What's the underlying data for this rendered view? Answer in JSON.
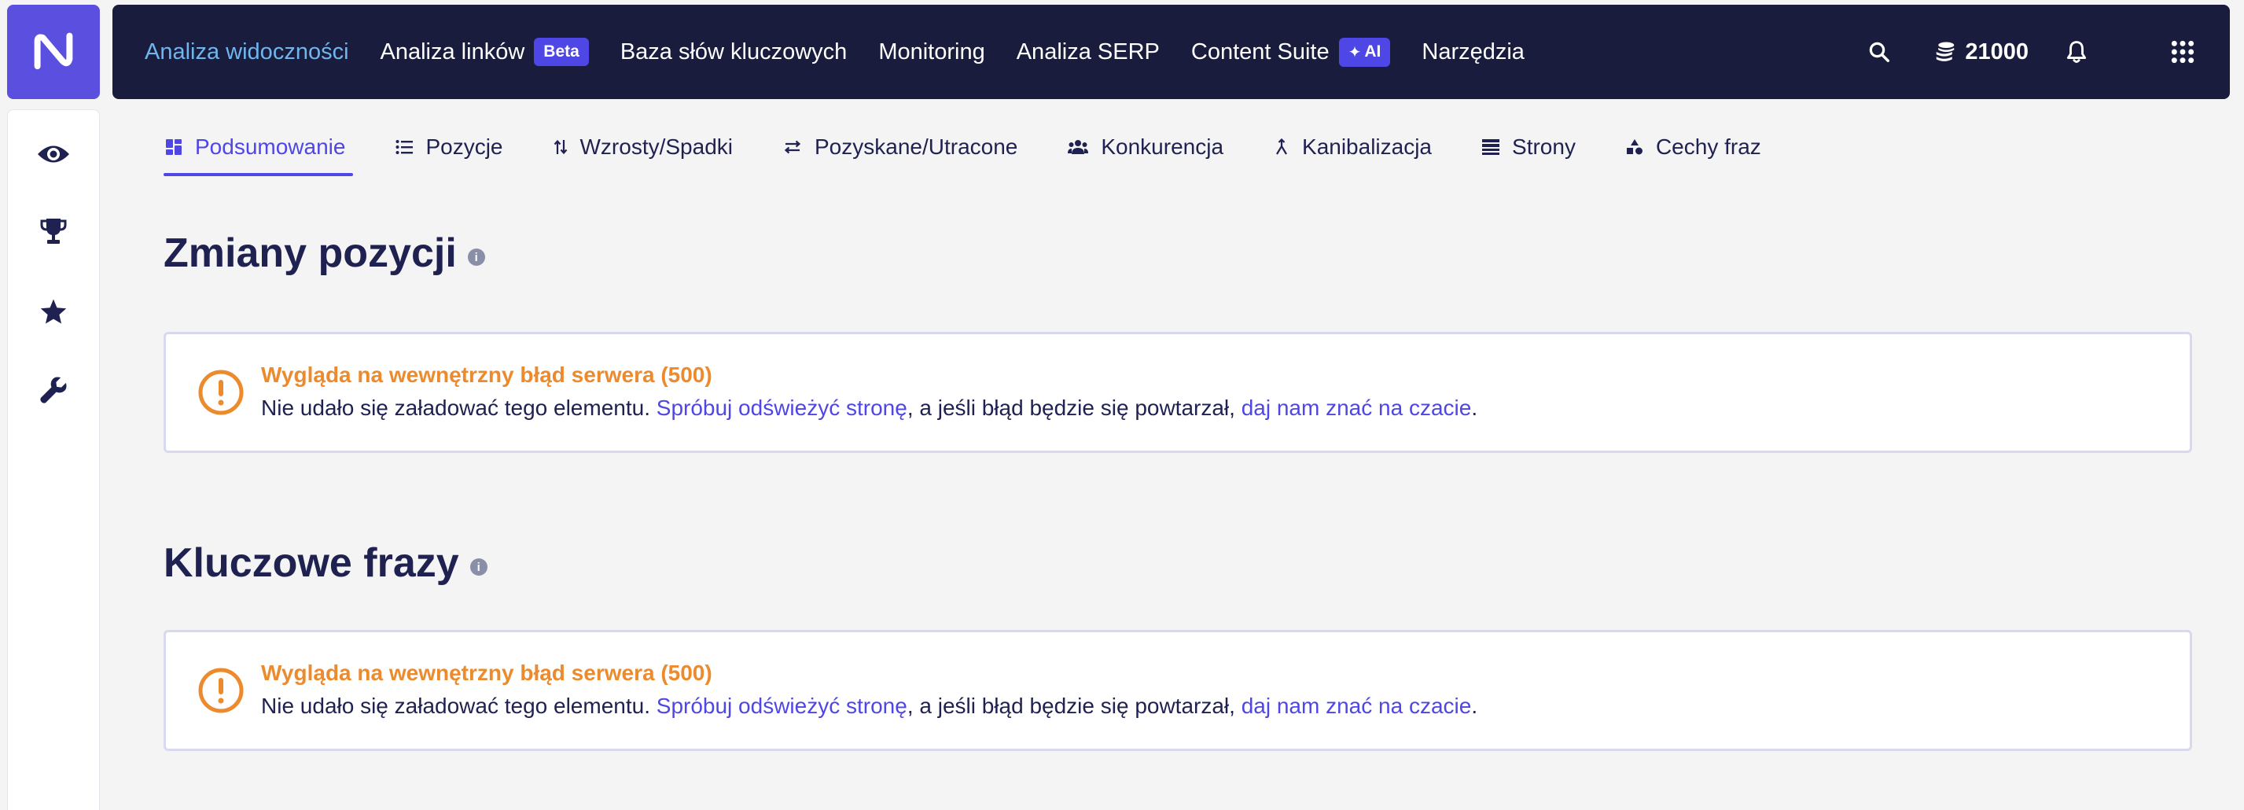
{
  "nav": {
    "items": [
      {
        "label": "Analiza widoczności",
        "active": true
      },
      {
        "label": "Analiza linków",
        "badge": "Beta"
      },
      {
        "label": "Baza słów kluczowych"
      },
      {
        "label": "Monitoring"
      },
      {
        "label": "Analiza SERP"
      },
      {
        "label": "Content Suite",
        "badge": "AI"
      },
      {
        "label": "Narzędzia"
      }
    ],
    "credits": "21000",
    "icons": [
      "search-icon",
      "coins-icon",
      "bell-icon",
      "apps-grid-icon"
    ]
  },
  "sidebar": {
    "icons": [
      "eye-icon",
      "trophy-icon",
      "star-icon",
      "wrench-icon"
    ]
  },
  "tabs": [
    {
      "label": "Podsumowanie",
      "icon": "dashboard-icon",
      "active": true
    },
    {
      "label": "Pozycje",
      "icon": "list-icon"
    },
    {
      "label": "Wzrosty/Spadki",
      "icon": "up-down-arrows-icon"
    },
    {
      "label": "Pozyskane/Utracone",
      "icon": "swap-arrows-icon"
    },
    {
      "label": "Konkurencja",
      "icon": "people-icon"
    },
    {
      "label": "Kanibalizacja",
      "icon": "merge-icon"
    },
    {
      "label": "Strony",
      "icon": "pages-icon"
    },
    {
      "label": "Cechy fraz",
      "icon": "shapes-icon"
    }
  ],
  "sections": [
    {
      "title": "Zmiany pozycji",
      "error": {
        "title": "Wygląda na wewnętrzny błąd serwera (500)",
        "text_before": "Nie udało się załadować tego elementu. ",
        "link_refresh": "Spróbuj odświeżyć stronę",
        "text_middle": ", a jeśli błąd będzie się powtarzał, ",
        "link_chat": "daj nam znać na czacie",
        "text_after": "."
      }
    },
    {
      "title": "Kluczowe frazy",
      "error": {
        "title": "Wygląda na wewnętrzny błąd serwera (500)",
        "text_before": "Nie udało się załadować tego elementu. ",
        "link_refresh": "Spróbuj odświeżyć stronę",
        "text_middle": ", a jeśli błąd będzie się powtarzał, ",
        "link_chat": "daj nam znać na czacie",
        "text_after": "."
      }
    }
  ],
  "colors": {
    "brand": "#5b4fe0",
    "accent": "#4e46e5",
    "nav_bg": "#1a1c3d",
    "nav_active": "#6fb6ee",
    "error": "#ec8b2e"
  }
}
